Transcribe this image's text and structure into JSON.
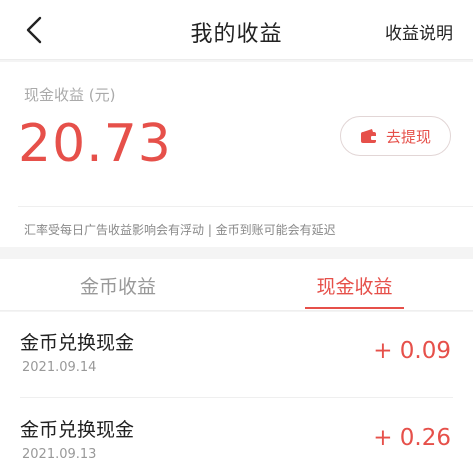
{
  "header": {
    "title": "我的收益",
    "help_link": "收益说明"
  },
  "balance": {
    "label": "现金收益 (元)",
    "amount": "20.73",
    "withdraw_label": "去提现",
    "note": "汇率受每日广告收益影响会有浮动 | 金币到账可能会有延迟"
  },
  "tabs": {
    "items": [
      {
        "label": "金币收益",
        "active": false
      },
      {
        "label": "现金收益",
        "active": true
      }
    ]
  },
  "records": [
    {
      "title": "金币兑换现金",
      "date": "2021.09.14",
      "amount": "+ 0.09"
    },
    {
      "title": "金币兑换现金",
      "date": "2021.09.13",
      "amount": "+ 0.26"
    }
  ],
  "colors": {
    "accent": "#e6504a",
    "text": "#222222",
    "muted": "#999999",
    "background": "#f4f4f4"
  },
  "icons": {
    "back": "chevron-left-icon",
    "withdraw": "wallet-icon"
  }
}
